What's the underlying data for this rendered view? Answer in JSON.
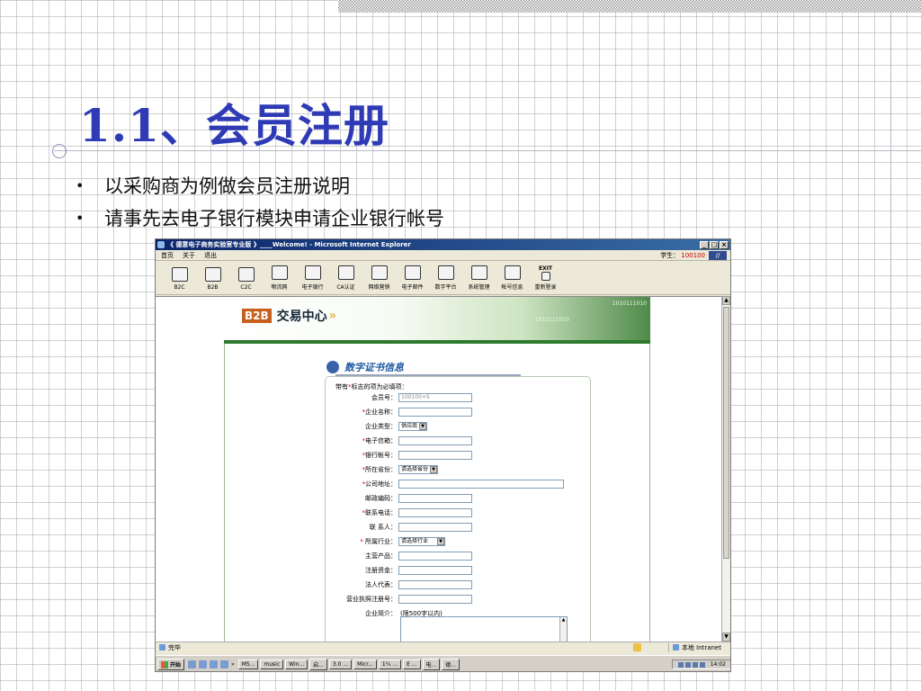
{
  "slide": {
    "title": "1.1、会员注册",
    "bullets": [
      "以采购商为例做会员注册说明",
      "请事先去电子银行模块申请企业银行帐号"
    ]
  },
  "window": {
    "title": "《 德意电子商务实验室专业版 》____Welcome! - Microsoft Internet Explorer",
    "buttons": [
      "_",
      "□",
      "×"
    ]
  },
  "menubar": {
    "items": [
      "首页",
      "关于",
      "退出"
    ],
    "student_label": "学生：",
    "student_id": "100100"
  },
  "toolbar": {
    "items": [
      {
        "label": "B2C",
        "icon": "b2c-icon"
      },
      {
        "label": "B2B",
        "icon": "b2b-icon"
      },
      {
        "label": "C2C",
        "icon": "c2c-icon"
      },
      {
        "label": "物流网",
        "icon": "logistics-icon"
      },
      {
        "label": "电子银行",
        "icon": "bank-icon"
      },
      {
        "label": "CA认证",
        "icon": "ca-icon"
      },
      {
        "label": "网络营销",
        "icon": "marketing-icon"
      },
      {
        "label": "电子邮件",
        "icon": "email-icon"
      },
      {
        "label": "数字平台",
        "icon": "digital-icon"
      },
      {
        "label": "系统管理",
        "icon": "system-icon"
      },
      {
        "label": "帐号信息",
        "icon": "account-icon"
      },
      {
        "label": "重新登录",
        "icon": "exit-icon",
        "exit_text": "EXIT"
      }
    ]
  },
  "banner": {
    "logo_mark": "B2B",
    "logo_text": "交易中心",
    "bits1": "1010111010",
    "bits2": "1010111010"
  },
  "form": {
    "section_title": "数字证书信息",
    "required_note_prefix": "带有",
    "required_note_star": "*",
    "required_note_suffix": "标志的项为必填项：",
    "fields": [
      {
        "label": "会员号：",
        "required": false,
        "type": "input",
        "value": "100100+S"
      },
      {
        "label": "企业名称：",
        "required": true,
        "type": "input",
        "value": ""
      },
      {
        "label": "企业类型：",
        "required": false,
        "type": "select",
        "value": "供应商"
      },
      {
        "label": "电子信箱：",
        "required": true,
        "type": "input",
        "value": ""
      },
      {
        "label": "银行帐号：",
        "required": true,
        "type": "input",
        "value": ""
      },
      {
        "label": "所在省份：",
        "required": true,
        "type": "select",
        "value": "请选择省份"
      },
      {
        "label": "公司地址：",
        "required": true,
        "type": "input-wide",
        "value": ""
      },
      {
        "label": "邮政编码：",
        "required": false,
        "type": "input",
        "value": ""
      },
      {
        "label": "联系电话：",
        "required": true,
        "type": "input",
        "value": ""
      },
      {
        "label": "联 系人：",
        "required": false,
        "type": "input",
        "value": ""
      },
      {
        "label": "所属行业：",
        "required": true,
        "type": "select",
        "value": "请选择行业"
      },
      {
        "label": "主营产品：",
        "required": false,
        "type": "input",
        "value": ""
      },
      {
        "label": "注册资金：",
        "required": false,
        "type": "input",
        "value": ""
      },
      {
        "label": "法人代表：",
        "required": false,
        "type": "input",
        "value": ""
      },
      {
        "label": "营业执照注册号：",
        "required": false,
        "type": "input",
        "value": ""
      },
      {
        "label": "企业简介：",
        "required": false,
        "type": "hint",
        "value": "(限500字以内)"
      }
    ]
  },
  "statusbar": {
    "done": "完毕",
    "zone": "本地 Intranet"
  },
  "taskbar": {
    "start": "开始",
    "tasks": [
      "M5...",
      "music",
      "Win...",
      "启...",
      "3.0 ...",
      "Micr...",
      "1¼ ...",
      "E ...",
      "电...",
      "德..."
    ],
    "clock": "14:02"
  }
}
